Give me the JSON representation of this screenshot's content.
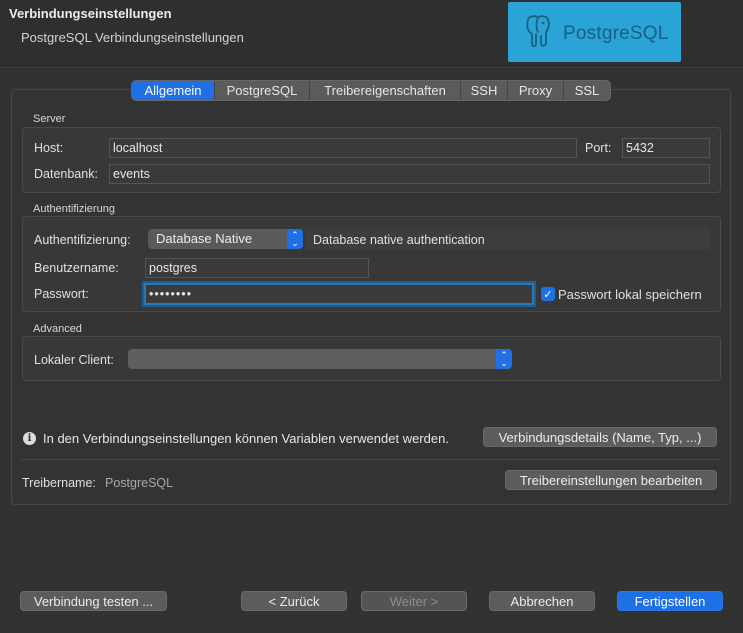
{
  "header": {
    "title": "Verbindungseinstellungen",
    "subtitle": "PostgreSQL Verbindungseinstellungen",
    "logo_text": "PostgreSQL"
  },
  "tabs": [
    {
      "label": "Allgemein",
      "active": true
    },
    {
      "label": "PostgreSQL"
    },
    {
      "label": "Treibereigenschaften"
    },
    {
      "label": "SSH"
    },
    {
      "label": "Proxy"
    },
    {
      "label": "SSL"
    }
  ],
  "server": {
    "group_label": "Server",
    "host_label": "Host:",
    "host_value": "localhost",
    "port_label": "Port:",
    "port_value": "5432",
    "database_label": "Datenbank:",
    "database_value": "events"
  },
  "auth": {
    "group_label": "Authentifizierung",
    "auth_label": "Authentifizierung:",
    "auth_value": "Database Native",
    "auth_description": "Database native authentication",
    "username_label": "Benutzername:",
    "username_value": "postgres",
    "password_label": "Passwort:",
    "password_value": "••••••••",
    "save_password_label": "Passwort lokal speichern",
    "save_password_checked": true
  },
  "advanced": {
    "group_label": "Advanced",
    "local_client_label": "Lokaler Client:",
    "local_client_value": ""
  },
  "info": {
    "text": "In den Verbindungseinstellungen können Variablen verwendet werden.",
    "details_button": "Verbindungsdetails (Name, Typ, ...)"
  },
  "driver": {
    "label": "Treibername:",
    "value": "PostgreSQL",
    "edit_button": "Treibereinstellungen bearbeiten"
  },
  "footer": {
    "test_button": "Verbindung testen ...",
    "back_button": "< Zurück",
    "next_button": "Weiter >",
    "cancel_button": "Abbrechen",
    "finish_button": "Fertigstellen"
  },
  "colors": {
    "accent": "#1f6fe5",
    "logo_bg": "#2aa3d6",
    "background": "#323232"
  }
}
